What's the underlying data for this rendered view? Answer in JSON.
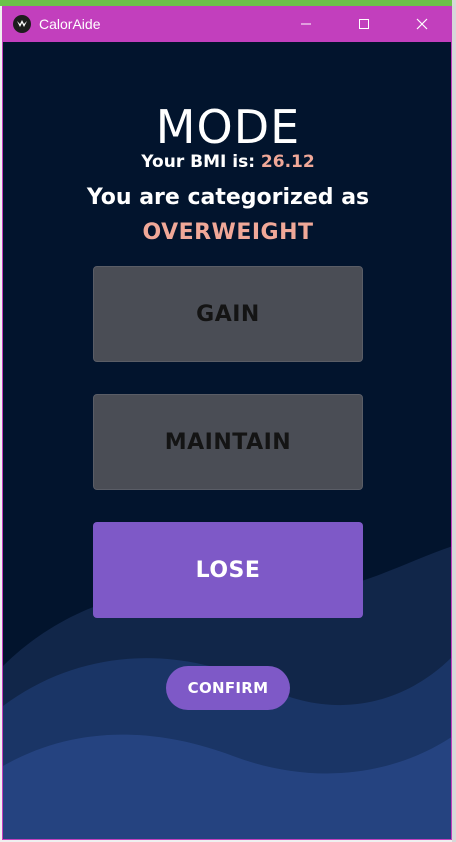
{
  "window": {
    "title": "CalorAide",
    "icon": "kivy-logo-icon",
    "controls": [
      "minimize-icon",
      "maximize-icon",
      "close-icon"
    ]
  },
  "screen": {
    "heading": "MODE",
    "bmi_label": "Your BMI is:",
    "bmi_value": "26.12",
    "category_label": "You are categorized as",
    "category_value": "OVERWEIGHT"
  },
  "modes": {
    "gain": "GAIN",
    "maintain": "MAINTAIN",
    "lose": "LOSE",
    "selected": "LOSE"
  },
  "actions": {
    "confirm": "CONFIRM"
  },
  "colors": {
    "titlebar": "#c23fbd",
    "background": "#02142d",
    "accent": "#7e59c7",
    "highlight_text": "#f0a898",
    "inactive_button": "#4a4d55"
  }
}
